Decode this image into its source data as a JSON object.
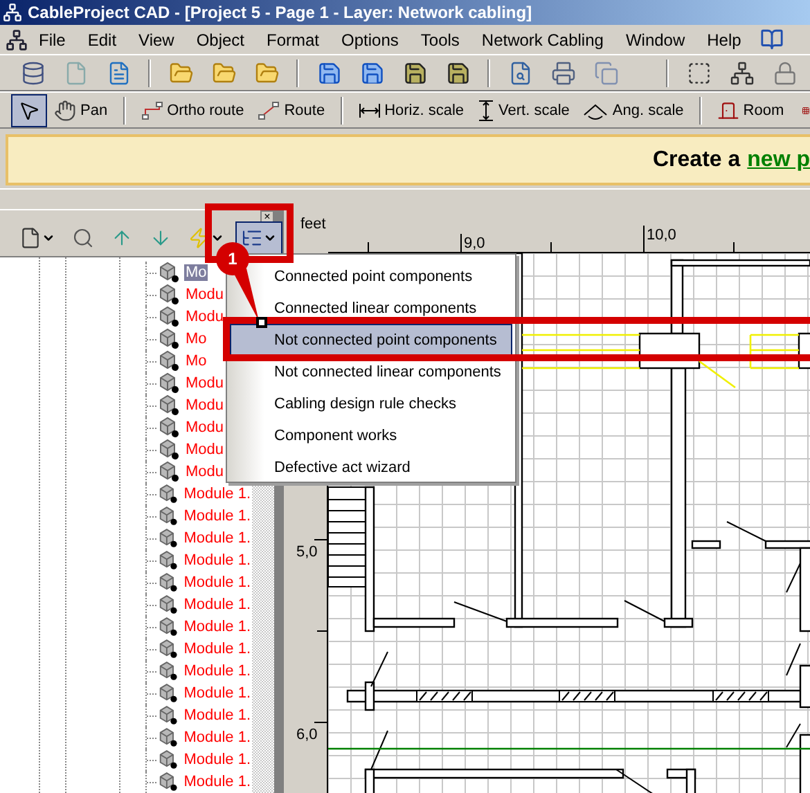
{
  "window": {
    "title": "CableProject CAD - [Project 5 - Page 1 - Layer: Network cabling]"
  },
  "menu_bar": [
    "File",
    "Edit",
    "View",
    "Object",
    "Format",
    "Options",
    "Tools",
    "Network Cabling",
    "Window",
    "Help"
  ],
  "draw_toolbar": [
    {
      "kind": "select",
      "selected": true
    },
    {
      "kind": "pan",
      "label": "Pan",
      "selected": false
    },
    {
      "kind": "ortho-route",
      "label": "Ortho route",
      "selected": false
    },
    {
      "kind": "route",
      "label": "Route",
      "selected": false
    },
    {
      "kind": "horizontal-scale",
      "label": "Horiz. scale",
      "selected": false
    },
    {
      "kind": "vertical-scale",
      "label": "Vert. scale",
      "selected": false
    },
    {
      "kind": "angle-scale",
      "label": "Ang. scale",
      "selected": false
    },
    {
      "kind": "room",
      "label": "Room",
      "selected": false
    }
  ],
  "banner": {
    "text": "Create a",
    "link": "new p"
  },
  "panel": {
    "close": "×"
  },
  "panel_toolbar": [
    {
      "kind": "new",
      "pressed": false
    },
    {
      "kind": "search",
      "pressed": false
    },
    {
      "kind": "up",
      "pressed": false
    },
    {
      "kind": "down",
      "pressed": false
    },
    {
      "kind": "lightning",
      "pressed": false
    },
    {
      "kind": "tree",
      "pressed": true
    }
  ],
  "tree": {
    "rows": [
      {
        "label": "Mo",
        "selected": true
      },
      {
        "label": "Modu",
        "selected": false
      },
      {
        "label": "Modu",
        "selected": false
      },
      {
        "label": "Mo",
        "selected": false
      },
      {
        "label": "Mo",
        "selected": false
      },
      {
        "label": "Modu",
        "selected": false
      },
      {
        "label": "Modu",
        "selected": false
      },
      {
        "label": "Modu",
        "selected": false
      },
      {
        "label": "Modu",
        "selected": false
      },
      {
        "label": "Modu",
        "selected": false
      },
      {
        "label": "Module 1.",
        "selected": false
      },
      {
        "label": "Module 1.",
        "selected": false
      },
      {
        "label": "Module 1.",
        "selected": false
      },
      {
        "label": "Module 1.",
        "selected": false
      },
      {
        "label": "Module 1.",
        "selected": false
      },
      {
        "label": "Module 1.",
        "selected": false
      },
      {
        "label": "Module 1.",
        "selected": false
      },
      {
        "label": "Module 1.",
        "selected": false
      },
      {
        "label": "Module 1.",
        "selected": false
      },
      {
        "label": "Module 1.",
        "selected": false
      },
      {
        "label": "Module 1.",
        "selected": false
      },
      {
        "label": "Module 1.",
        "selected": false
      },
      {
        "label": "Module 1.",
        "selected": false
      },
      {
        "label": "Module 1.",
        "selected": false
      }
    ]
  },
  "popup_menu": {
    "items": [
      {
        "label": "Connected point components",
        "selected": false
      },
      {
        "label": "Connected linear components",
        "selected": false
      },
      {
        "label": "Not connected point components",
        "selected": true
      },
      {
        "label": "Not connected linear components",
        "selected": false
      },
      {
        "label": "Cabling design rule checks",
        "selected": false
      },
      {
        "label": "Component works",
        "selected": false
      },
      {
        "label": "Defective act wizard",
        "selected": false
      }
    ]
  },
  "ruler": {
    "unit": "feet",
    "x_labels": [
      "9,0",
      "10,0"
    ],
    "y_labels": [
      "5,0",
      "6,0"
    ]
  },
  "callout": {
    "number": "1"
  }
}
